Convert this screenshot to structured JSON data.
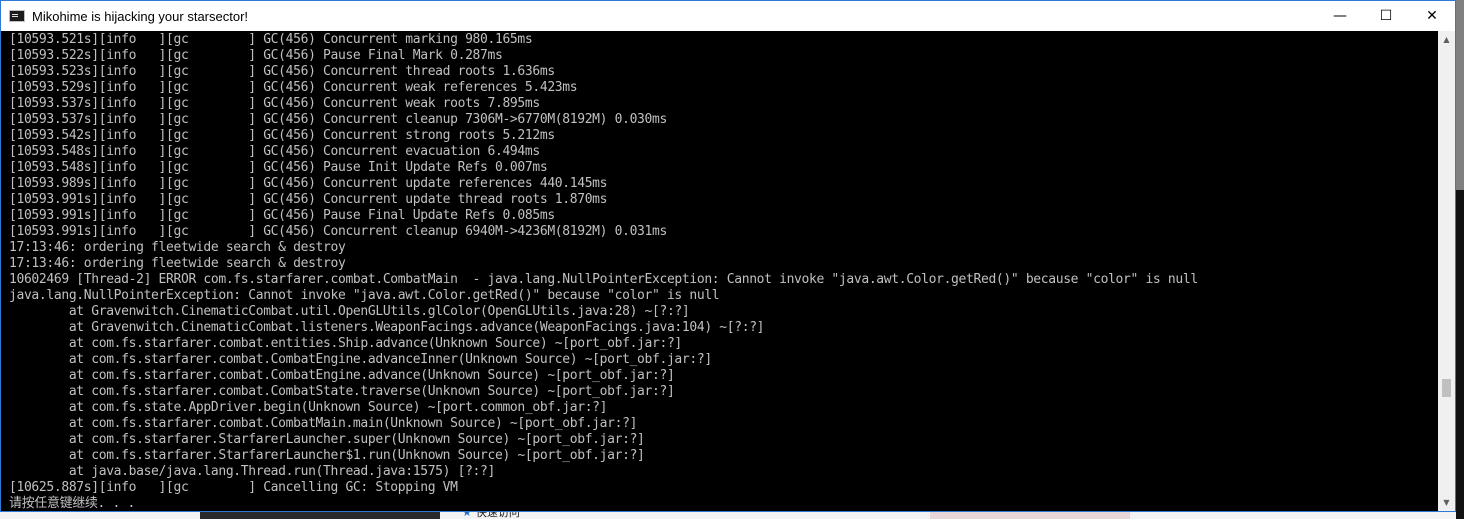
{
  "window": {
    "title": "Mikohime is hijacking your starsector!",
    "controls": {
      "minimize": "—",
      "maximize": "☐",
      "close": "✕"
    }
  },
  "background": {
    "quick_access": "快速访问",
    "quick_access_icon": "star-icon"
  },
  "console": {
    "lines": [
      "[10593.521s][info   ][gc        ] GC(456) Concurrent marking 980.165ms",
      "[10593.522s][info   ][gc        ] GC(456) Pause Final Mark 0.287ms",
      "[10593.523s][info   ][gc        ] GC(456) Concurrent thread roots 1.636ms",
      "[10593.529s][info   ][gc        ] GC(456) Concurrent weak references 5.423ms",
      "[10593.537s][info   ][gc        ] GC(456) Concurrent weak roots 7.895ms",
      "[10593.537s][info   ][gc        ] GC(456) Concurrent cleanup 7306M->6770M(8192M) 0.030ms",
      "[10593.542s][info   ][gc        ] GC(456) Concurrent strong roots 5.212ms",
      "[10593.548s][info   ][gc        ] GC(456) Concurrent evacuation 6.494ms",
      "[10593.548s][info   ][gc        ] GC(456) Pause Init Update Refs 0.007ms",
      "[10593.989s][info   ][gc        ] GC(456) Concurrent update references 440.145ms",
      "[10593.991s][info   ][gc        ] GC(456) Concurrent update thread roots 1.870ms",
      "[10593.991s][info   ][gc        ] GC(456) Pause Final Update Refs 0.085ms",
      "[10593.991s][info   ][gc        ] GC(456) Concurrent cleanup 6940M->4236M(8192M) 0.031ms",
      "17:13:46: ordering fleetwide search & destroy",
      "17:13:46: ordering fleetwide search & destroy",
      "10602469 [Thread-2] ERROR com.fs.starfarer.combat.CombatMain  - java.lang.NullPointerException: Cannot invoke \"java.awt.Color.getRed()\" because \"color\" is null",
      "java.lang.NullPointerException: Cannot invoke \"java.awt.Color.getRed()\" because \"color\" is null",
      "        at Gravenwitch.CinematicCombat.util.OpenGLUtils.glColor(OpenGLUtils.java:28) ~[?:?]",
      "        at Gravenwitch.CinematicCombat.listeners.WeaponFacings.advance(WeaponFacings.java:104) ~[?:?]",
      "        at com.fs.starfarer.combat.entities.Ship.advance(Unknown Source) ~[port_obf.jar:?]",
      "        at com.fs.starfarer.combat.CombatEngine.advanceInner(Unknown Source) ~[port_obf.jar:?]",
      "        at com.fs.starfarer.combat.CombatEngine.advance(Unknown Source) ~[port_obf.jar:?]",
      "        at com.fs.starfarer.combat.CombatState.traverse(Unknown Source) ~[port_obf.jar:?]",
      "        at com.fs.state.AppDriver.begin(Unknown Source) ~[port.common_obf.jar:?]",
      "        at com.fs.starfarer.combat.CombatMain.main(Unknown Source) ~[port_obf.jar:?]",
      "        at com.fs.starfarer.StarfarerLauncher.super(Unknown Source) ~[port_obf.jar:?]",
      "        at com.fs.starfarer.StarfarerLauncher$1.run(Unknown Source) ~[port_obf.jar:?]",
      "        at java.base/java.lang.Thread.run(Thread.java:1575) [?:?]",
      "[10625.887s][info   ][gc        ] Cancelling GC: Stopping VM",
      "请按任意键继续. . ."
    ]
  },
  "scrollbar": {
    "up_arrow": "▲",
    "down_arrow": "▼"
  },
  "colors": {
    "console_bg": "#000000",
    "console_text": "#c0c0c0",
    "window_border": "#2d7ad6"
  }
}
